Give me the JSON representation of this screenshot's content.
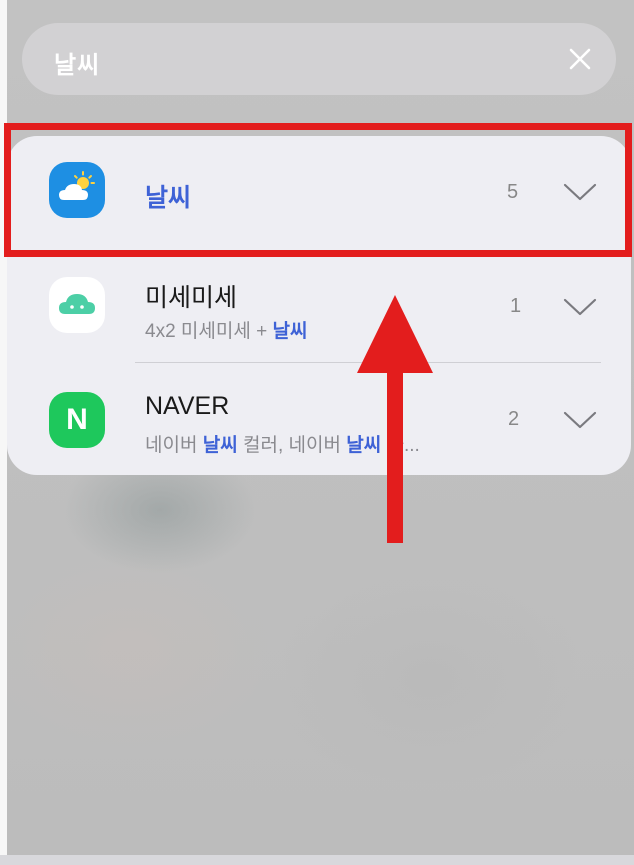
{
  "search": {
    "query": "날씨"
  },
  "results": [
    {
      "name": "날씨",
      "count": "5"
    },
    {
      "name": "미세미세",
      "sub_prefix": "4x2 미세미세 + ",
      "sub_highlight": "날씨",
      "count": "1"
    },
    {
      "name": "NAVER",
      "sub_part1": "네이버 ",
      "sub_hl1": "날씨",
      "sub_part2": " 컬러, 네이버 ",
      "sub_hl2": "날씨",
      "sub_part3": " 화...",
      "icon_letter": "N",
      "count": "2"
    }
  ],
  "colors": {
    "highlight": "#3e62d6",
    "annotation_red": "#e31d1d",
    "weather_icon_bg": "#1e8fe3",
    "naver_icon_bg": "#1ec85c",
    "mise_icon_fg": "#4ccfa6"
  },
  "icons": [
    "weather-app-icon",
    "mise-app-icon",
    "naver-app-icon",
    "close-icon",
    "chevron-down-icon"
  ]
}
